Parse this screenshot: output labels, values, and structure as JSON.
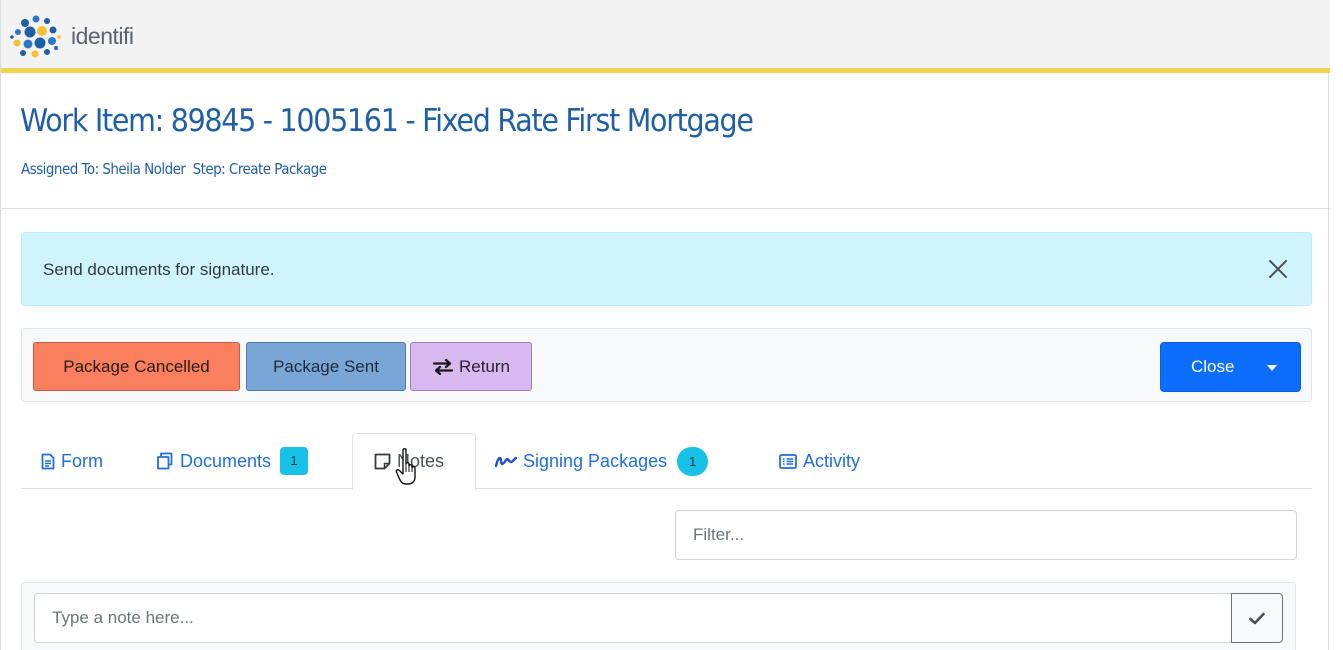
{
  "brand": {
    "name": "identifi"
  },
  "header": {
    "title": "Work Item: 89845 - 1005161 - Fixed Rate First Mortgage",
    "assigned_to": "Assigned To: Sheila Nolder",
    "step": "Step: Create Package"
  },
  "alert": {
    "message": "Send documents for signature."
  },
  "toolbar": {
    "package_cancelled_label": "Package Cancelled",
    "package_sent_label": "Package Sent",
    "return_label": "Return",
    "close_label": "Close"
  },
  "tabs": [
    {
      "label": "Form"
    },
    {
      "label": "Documents",
      "badge": "1"
    },
    {
      "label": "Notes",
      "active": true
    },
    {
      "label": "Signing Packages",
      "badge": "1"
    },
    {
      "label": "Activity"
    }
  ],
  "filter": {
    "placeholder": "Filter..."
  },
  "note": {
    "placeholder": "Type a note here..."
  },
  "colors": {
    "brand_yellow": "#f2d44c",
    "title_blue": "#1f5fa8",
    "alert_bg": "#cff4fc",
    "package_cancelled": "#f97f5e",
    "package_sent": "#7aa6d6",
    "return": "#d7b8ef",
    "close": "#0d6efd",
    "tab_link": "#1f6fe0",
    "badge": "#17c1e8"
  },
  "icons": {
    "logo": "identifi-logo",
    "alert_close": "close-icon",
    "return": "arrows-exchange-icon",
    "form_tab": "file-text-icon",
    "documents_tab": "copy-files-icon",
    "notes_tab": "sticky-note-icon",
    "signing_tab": "signature-icon",
    "activity_tab": "list-alt-icon",
    "note_submit": "check-icon",
    "cursor": "hand-pointer-icon"
  }
}
